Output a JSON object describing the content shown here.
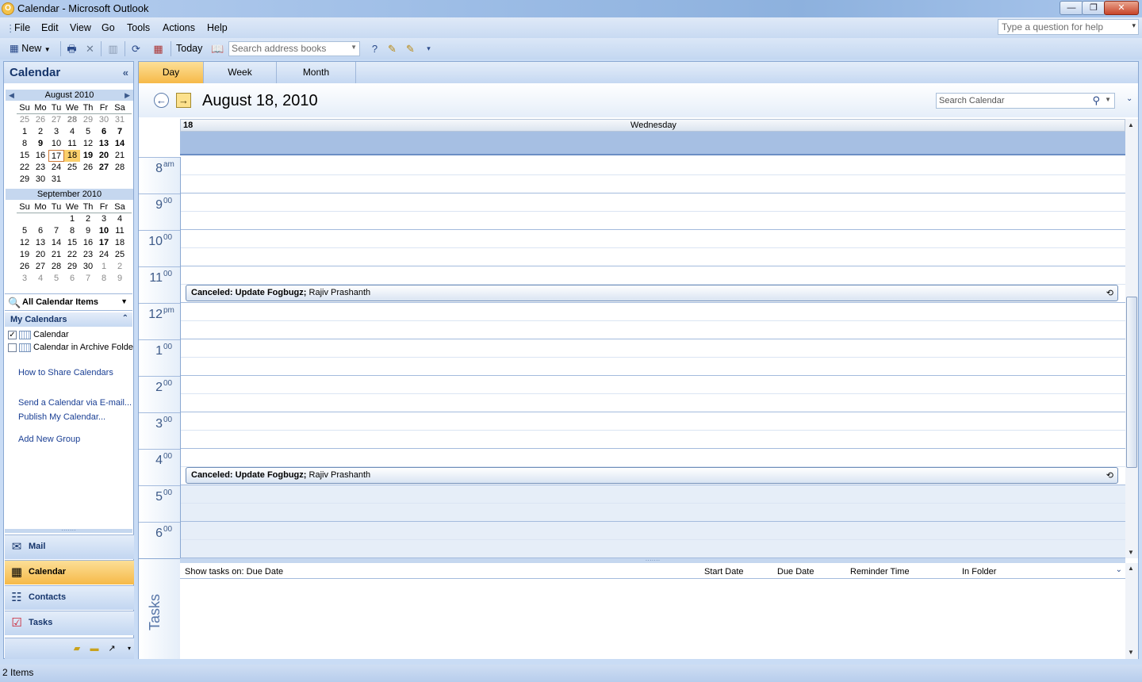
{
  "window": {
    "title": "Calendar - Microsoft Outlook",
    "icon": "outlook-app-icon"
  },
  "menu": [
    "File",
    "Edit",
    "View",
    "Go",
    "Tools",
    "Actions",
    "Help"
  ],
  "help_box": {
    "placeholder": "Type a question for help"
  },
  "toolbar": {
    "new_label": "New",
    "today_label": "Today",
    "search_placeholder": "Search address books"
  },
  "left": {
    "title": "Calendar",
    "month1": {
      "label": "August 2010",
      "days_of_week": [
        "Su",
        "Mo",
        "Tu",
        "We",
        "Th",
        "Fr",
        "Sa"
      ],
      "weeks": [
        [
          "25",
          "26",
          "27",
          "28",
          "29",
          "30",
          "31"
        ],
        [
          "1",
          "2",
          "3",
          "4",
          "5",
          "6",
          "7"
        ],
        [
          "8",
          "9",
          "10",
          "11",
          "12",
          "13",
          "14"
        ],
        [
          "15",
          "16",
          "17",
          "18",
          "19",
          "20",
          "21"
        ],
        [
          "22",
          "23",
          "24",
          "25",
          "26",
          "27",
          "28"
        ],
        [
          "29",
          "30",
          "31",
          "",
          "",
          "",
          ""
        ]
      ]
    },
    "month2": {
      "label": "September 2010",
      "days_of_week": [
        "Su",
        "Mo",
        "Tu",
        "We",
        "Th",
        "Fr",
        "Sa"
      ],
      "weeks": [
        [
          "",
          "",
          "",
          "1",
          "2",
          "3",
          "4"
        ],
        [
          "5",
          "6",
          "7",
          "8",
          "9",
          "10",
          "11"
        ],
        [
          "12",
          "13",
          "14",
          "15",
          "16",
          "17",
          "18"
        ],
        [
          "19",
          "20",
          "21",
          "22",
          "23",
          "24",
          "25"
        ],
        [
          "26",
          "27",
          "28",
          "29",
          "30",
          "1",
          "2"
        ],
        [
          "3",
          "4",
          "5",
          "6",
          "7",
          "8",
          "9"
        ]
      ]
    },
    "all_items_label": "All Calendar Items",
    "my_calendars_label": "My Calendars",
    "calendars": [
      {
        "label": "Calendar",
        "checked": true
      },
      {
        "label": "Calendar in Archive Folders",
        "checked": false
      }
    ],
    "links": [
      "How to Share Calendars",
      "Send a Calendar via E-mail...",
      "Publish My Calendar...",
      "Add New Group"
    ],
    "nav": [
      {
        "label": "Mail",
        "icon": "mail-icon"
      },
      {
        "label": "Calendar",
        "icon": "calendar-icon"
      },
      {
        "label": "Contacts",
        "icon": "contacts-icon"
      },
      {
        "label": "Tasks",
        "icon": "tasks-icon"
      }
    ]
  },
  "main": {
    "tabs": [
      "Day",
      "Week",
      "Month"
    ],
    "date_title": "August 18, 2010",
    "search_placeholder": "Search Calendar",
    "day_number": "18",
    "day_of_week": "Wednesday",
    "hours": [
      {
        "h": "8",
        "m": "am"
      },
      {
        "h": "9",
        "m": "00"
      },
      {
        "h": "10",
        "m": "00"
      },
      {
        "h": "11",
        "m": "00"
      },
      {
        "h": "12",
        "m": "pm"
      },
      {
        "h": "1",
        "m": "00"
      },
      {
        "h": "2",
        "m": "00"
      },
      {
        "h": "3",
        "m": "00"
      },
      {
        "h": "4",
        "m": "00"
      },
      {
        "h": "5",
        "m": "00"
      },
      {
        "h": "6",
        "m": "00"
      }
    ],
    "appointments": [
      {
        "status": "Canceled: Update Fogbugz;",
        "organizer": "Rajiv Prashanth",
        "start": "11:30",
        "end": "12:00"
      },
      {
        "status": "Canceled: Update Fogbugz;",
        "organizer": "Rajiv Prashanth",
        "start": "4:30",
        "end": "5:00"
      }
    ],
    "tasks": {
      "label": "Tasks",
      "show_label": "Show tasks on: Due Date",
      "columns": [
        "Start Date",
        "Due Date",
        "Reminder Time",
        "In Folder"
      ]
    }
  },
  "status": {
    "items": "2 Items"
  }
}
